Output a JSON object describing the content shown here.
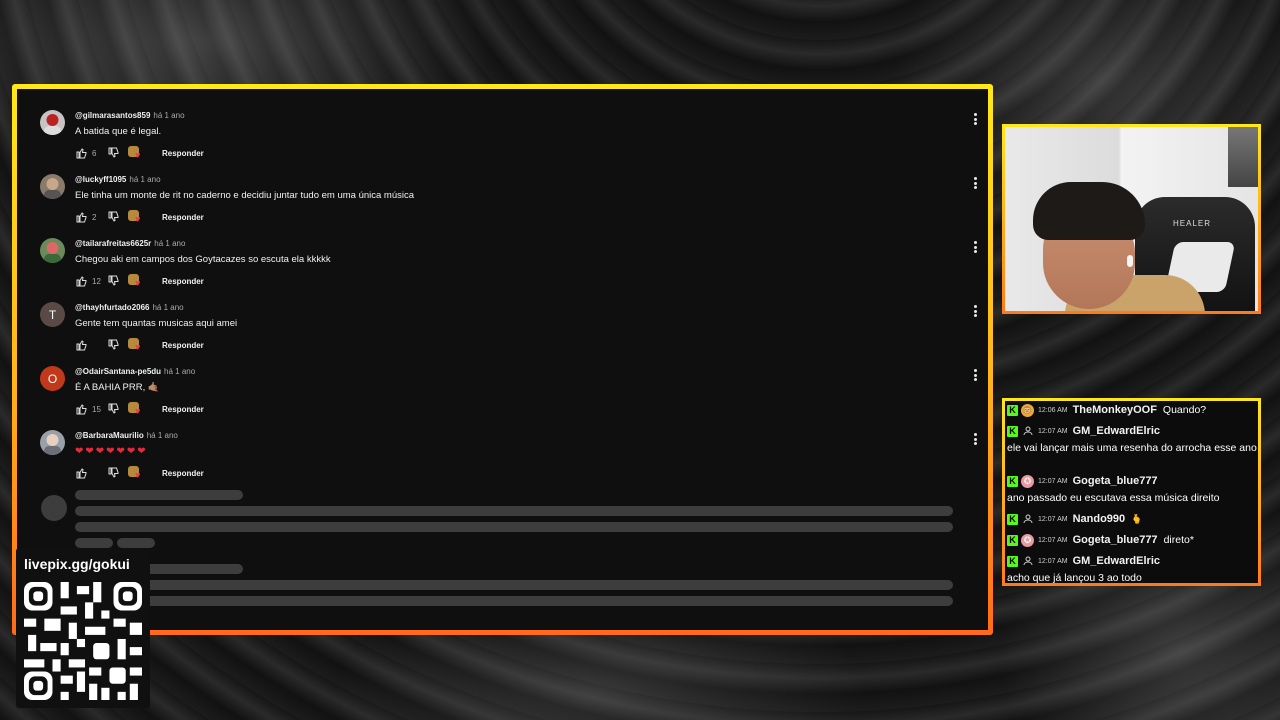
{
  "comments": [
    {
      "author": "@gilmarasantos859",
      "time": "há 1 ano",
      "text": "A batida que é legal.",
      "likes": "6",
      "reply": "Responder",
      "avatar_color": "#c8c3c3",
      "avatar_letter": ""
    },
    {
      "author": "@luckyff1095",
      "time": "há 1 ano",
      "text": "Ele tinha um monte de rit no caderno e decidiu juntar tudo em uma única música",
      "likes": "2",
      "reply": "Responder",
      "avatar_color": "#8a7a6a",
      "avatar_letter": ""
    },
    {
      "author": "@tailarafreitas6625r",
      "time": "há 1 ano",
      "text": "Chegou aki em campos dos Goytacazes so escuta ela kkkkk",
      "likes": "12",
      "reply": "Responder",
      "avatar_color": "#6a8a5a",
      "avatar_letter": ""
    },
    {
      "author": "@thayhfurtado2066",
      "time": "há 1 ano",
      "text": "Gente tem quantas musicas aqui amei",
      "likes": "",
      "reply": "Responder",
      "avatar_color": "#5a4a45",
      "avatar_letter": "T"
    },
    {
      "author": "@OdairSantana-pe5du",
      "time": "há 1 ano",
      "text": "É A BAHIA PRR, 🤙🏽",
      "likes": "15",
      "reply": "Responder",
      "avatar_color": "#c0391b",
      "avatar_letter": "O"
    },
    {
      "author": "@BarbaraMaurilio",
      "time": "há 1 ano",
      "text": "❤❤❤❤❤❤❤",
      "likes": "",
      "reply": "Responder",
      "avatar_color": "#9aa0a8",
      "avatar_letter": ""
    }
  ],
  "chat": [
    {
      "time": "12:06 AM",
      "user": "TheMonkeyOOF",
      "msg": "Quando?",
      "badge": "monkey"
    },
    {
      "time": "12:07 AM",
      "user": "GM_EdwardElric",
      "msg": "ele vai lançar mais uma resenha do arrocha esse ano",
      "badge": "user"
    },
    {
      "time": "12:07 AM",
      "user": "Gogeta_blue777",
      "msg": "ano passado eu escutava essa música direito",
      "badge": "goku"
    },
    {
      "time": "12:07 AM",
      "user": "Nando990",
      "msg": "🫰",
      "badge": "user"
    },
    {
      "time": "12:07 AM",
      "user": "Gogeta_blue777",
      "msg": "direto*",
      "badge": "goku"
    },
    {
      "time": "12:07 AM",
      "user": "GM_EdwardElric",
      "msg": "acho que já lançou 3 ao todo",
      "badge": "user"
    }
  ],
  "kick_letter": "K",
  "livepix": {
    "label": "livepix.gg/gokui"
  },
  "webcam": {
    "chair_brand": "HEALER"
  },
  "colors": {
    "frame_top": "#ffe81a",
    "frame_bottom": "#ff6a1a",
    "kick_green": "#53fc18",
    "heart_red": "#ff3355"
  }
}
